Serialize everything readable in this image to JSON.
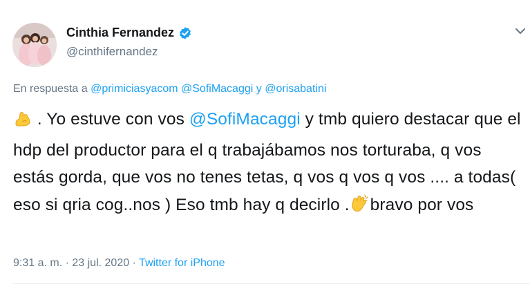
{
  "author": {
    "name": "Cinthia Fernandez",
    "handle": "@cinthifernandez"
  },
  "reply": {
    "prefix": "En respuesta a",
    "mention_1": "@primiciasyacom",
    "mention_2": "@SofiMacaggi",
    "conjunction": "y",
    "mention_3": "@orisabatini"
  },
  "tweet": {
    "emoji_start": "flexed-biceps",
    "text_before_mention": " . Yo estuve con vos ",
    "inline_mention": "@SofiMacaggi",
    "text_after_mention": " y tmb quiero destacar que el hdp del productor para el q trabajábamos nos torturaba, q vos estás gorda, que vos no tenes tetas, q vos q vos q vos .... a todas( eso si qria cog..nos ) Eso tmb hay q decirlo .",
    "emoji_clap": "clapping-hands",
    "text_end": "bravo por vos"
  },
  "meta": {
    "time": "9:31 a. m.",
    "separator_1": " · ",
    "date": "23 jul. 2020",
    "separator_2": " · ",
    "source": "Twitter for iPhone"
  },
  "colors": {
    "link": "#1da1f2",
    "secondary_text": "#657786",
    "primary_text": "#14171a",
    "verified": "#1da1f2"
  }
}
